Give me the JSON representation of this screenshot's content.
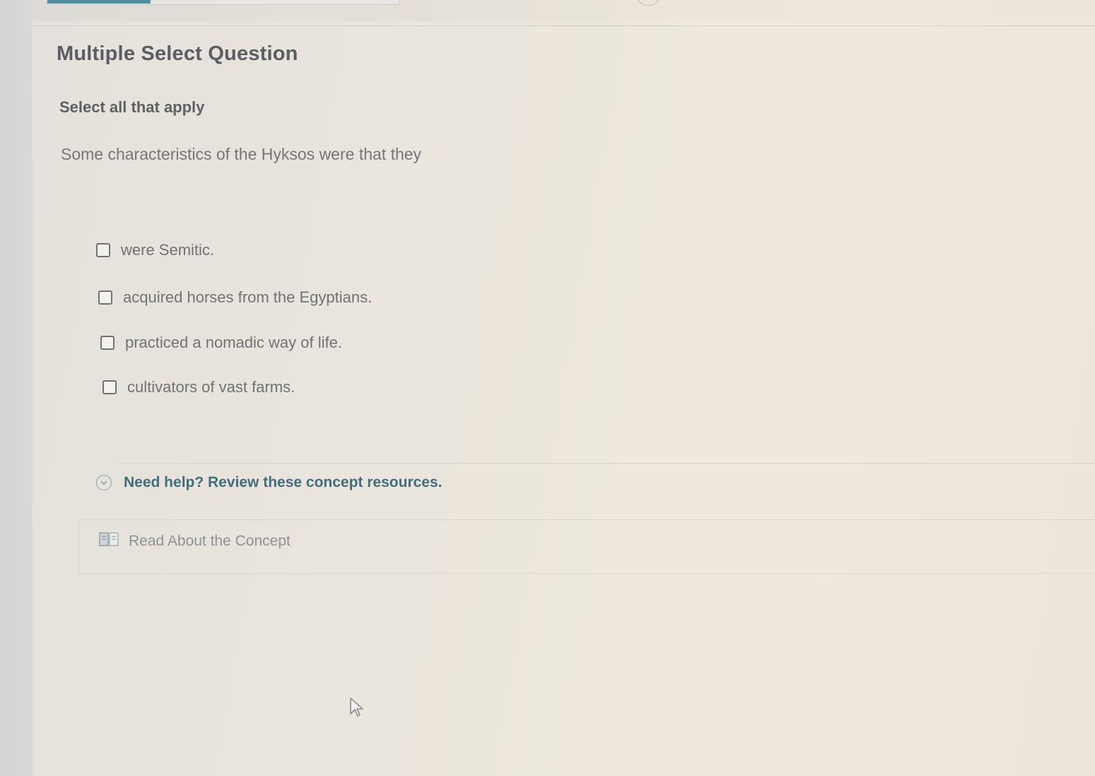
{
  "question": {
    "type_title": "Multiple Select Question",
    "instruction": "Select all that apply",
    "prompt": "Some characteristics of the Hyksos were that they"
  },
  "options": [
    {
      "label": "were Semitic.",
      "checked": false
    },
    {
      "label": "acquired horses from the Egyptians.",
      "checked": false
    },
    {
      "label": "practiced a nomadic way of life.",
      "checked": false
    },
    {
      "label": "cultivators of vast farms.",
      "checked": false
    }
  ],
  "help": {
    "toggle_label": "Need help? Review these concept resources.",
    "icon": "chevron-down-circle-icon"
  },
  "resources": {
    "read_label": "Read About the Concept",
    "icon": "book-icon"
  },
  "colors": {
    "accent": "#4f8ea1",
    "help_text": "#3f6f7c",
    "title_text": "#5a5e62"
  }
}
